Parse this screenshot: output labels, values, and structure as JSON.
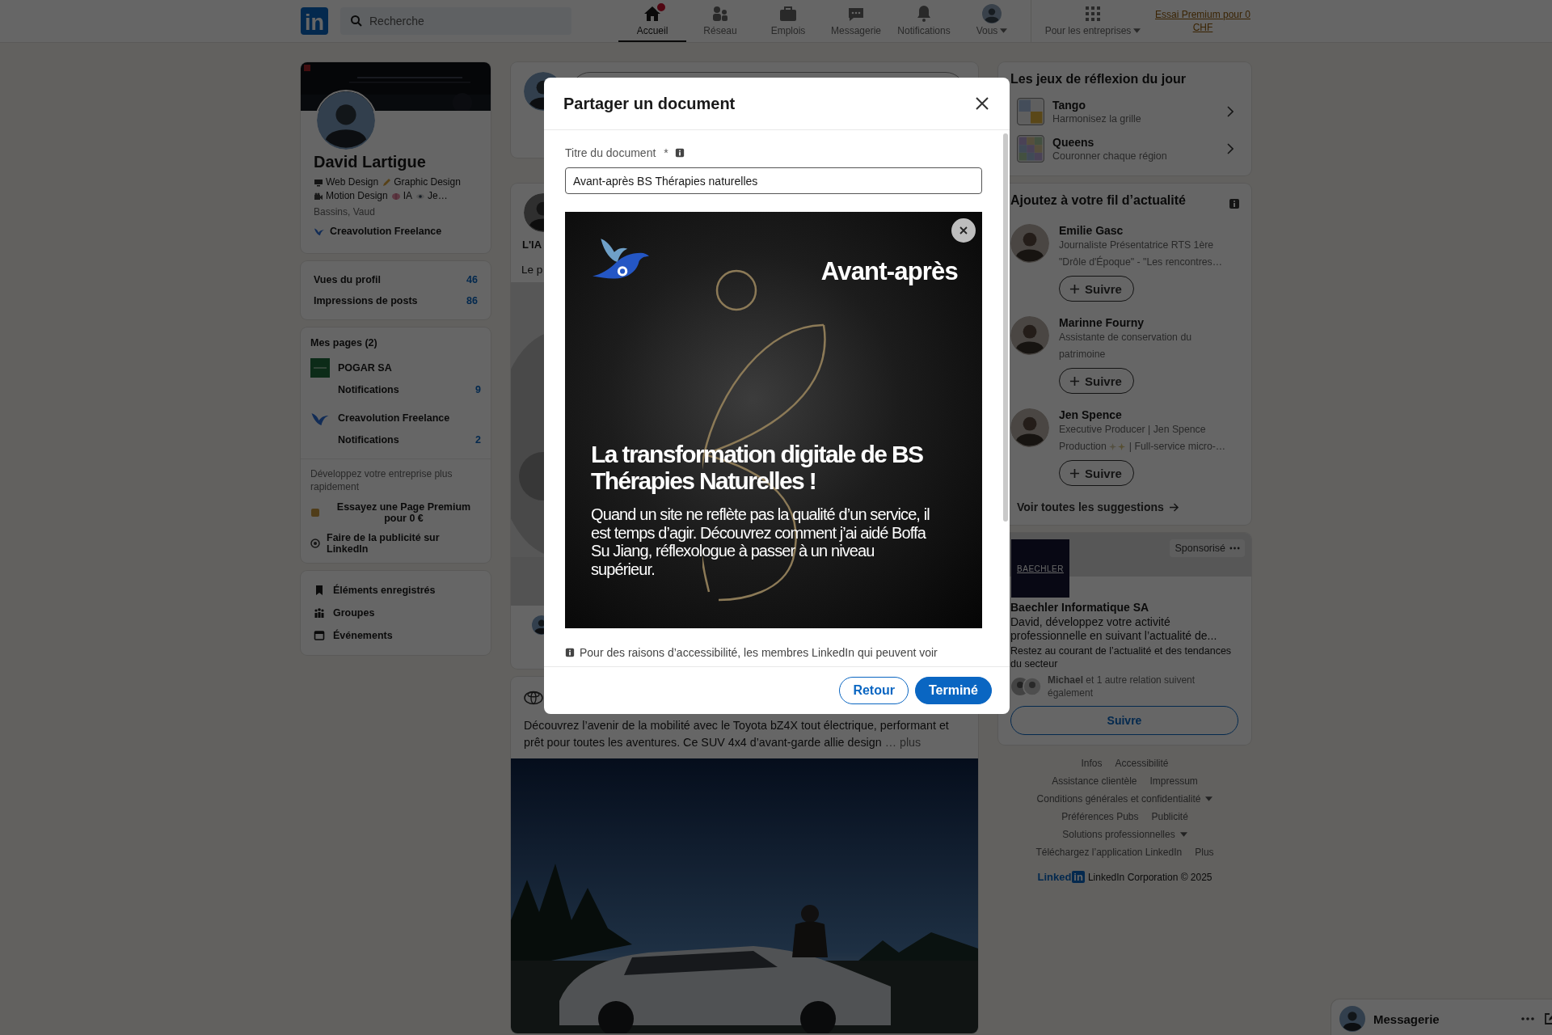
{
  "nav": {
    "logo": "in",
    "search": {
      "placeholder": "Recherche"
    },
    "items": [
      {
        "kind": "home",
        "label": "Accueil",
        "selected": true,
        "badge": true
      },
      {
        "kind": "network",
        "label": "Réseau",
        "selected": false,
        "badge": false
      },
      {
        "kind": "jobs",
        "label": "Emplois",
        "selected": false,
        "badge": false
      },
      {
        "kind": "messaging",
        "label": "Messagerie",
        "selected": false,
        "badge": false
      },
      {
        "kind": "notifications",
        "label": "Notifications",
        "selected": false,
        "badge": false
      },
      {
        "kind": "me",
        "label": "Vous",
        "selected": false,
        "badge": false
      }
    ],
    "business": "Pour les entreprises",
    "premium_link": "Essai Premium pour 0 CHF"
  },
  "profile": {
    "name": "David Lartigue",
    "headline": [
      "Web Design",
      "Graphic Design",
      "Motion Design",
      "IA",
      "Je…"
    ],
    "location": "Bassins, Vaud",
    "company": "Creavolution Freelance"
  },
  "stats": [
    {
      "label": "Vues du profil",
      "value": "46"
    },
    {
      "label": "Impressions de posts",
      "value": "86"
    }
  ],
  "pages": {
    "title": "Mes pages (2)",
    "items": [
      {
        "kind": "pogar",
        "name": "POGAR SA",
        "notif_label": "Notifications",
        "count": "9"
      },
      {
        "kind": "bird",
        "name": "Creavolution Freelance",
        "notif_label": "Notifications",
        "count": "2"
      }
    ],
    "promo": "Développez votre entreprise plus rapidement",
    "actions": [
      {
        "kind": "premium",
        "label": "Essayez une Page Premium pour 0 €"
      },
      {
        "kind": "ads",
        "label": "Faire de la publicité sur LinkedIn"
      }
    ]
  },
  "shortcuts": [
    {
      "kind": "bookmark",
      "label": "Éléments enregistrés"
    },
    {
      "kind": "groups",
      "label": "Groupes"
    },
    {
      "kind": "events",
      "label": "Événements"
    }
  ],
  "feed": {
    "post_author": "L'IA",
    "post_text": "Le p",
    "sponsored_text": "Découvrez l’avenir de la mobilité avec le Toyota bZ4X tout électrique, performant et prêt pour toutes les aventures. Ce SUV 4x4 d’avant-garde allie design",
    "more": "… plus"
  },
  "games": {
    "title": "Les jeux de réflexion du jour",
    "items": [
      {
        "kind": "tango",
        "name": "Tango",
        "subtitle": "Harmonisez la grille"
      },
      {
        "kind": "queens",
        "name": "Queens",
        "subtitle": "Couronner chaque région"
      }
    ]
  },
  "suggestions": {
    "title": "Ajoutez à votre fil d’actualité",
    "people": [
      {
        "name": "Emilie Gasc",
        "lines": [
          [
            "Journaliste Présentatrice RTS 1ère"
          ],
          [
            "\"Drôle d'Époque\" - \"Les rencontres…"
          ]
        ],
        "button": "Suivre"
      },
      {
        "name": "Marinne Fourny",
        "lines": [
          [
            "Assistante de conservation du"
          ],
          [
            "patrimoine"
          ]
        ],
        "button": "Suivre"
      },
      {
        "name": "Jen Spence",
        "lines": [
          [
            "Executive Producer | Jen Spence"
          ],
          [
            "Production",
            "| Full-service micro-…"
          ]
        ],
        "button": "Suivre"
      }
    ],
    "see_all": "Voir toutes les suggestions"
  },
  "ad": {
    "sponsored": "Sponsorisé",
    "logo_text": "BAECHLER",
    "company": "Baechler Informatique SA",
    "headline": "David, développez votre activité professionnelle en suivant l’actualité de...",
    "body": "Restez au courant de l’actualité et des tendances du secteur",
    "social": "**Michael** et 1 autre relation suivent également",
    "button": "Suivre"
  },
  "footer": {
    "rows": [
      [
        {
          "label": "Infos",
          "kind": "link"
        },
        {
          "label": "Accessibilité",
          "kind": "link"
        }
      ],
      [
        {
          "label": "Assistance clientèle",
          "kind": "link"
        },
        {
          "label": "Impressum",
          "kind": "link"
        }
      ],
      [
        {
          "label": "Conditions générales et confidentialité",
          "kind": "menu"
        }
      ],
      [
        {
          "label": "Préférences Pubs",
          "kind": "link"
        },
        {
          "label": "Publicité",
          "kind": "link"
        }
      ],
      [
        {
          "label": "Solutions professionnelles",
          "kind": "menu"
        }
      ],
      [
        {
          "label": "Téléchargez l’application LinkedIn",
          "kind": "link"
        },
        {
          "label": "Plus",
          "kind": "link"
        }
      ]
    ],
    "brand": "Linked",
    "brand_box": "in",
    "copyright": "LinkedIn Corporation © 2025"
  },
  "messaging": {
    "label": "Messagerie"
  },
  "modal": {
    "title": "Partager un document",
    "field_label": "Titre du document",
    "required_mark": "*",
    "value": "Avant-après BS Thérapies naturelles",
    "document": {
      "tag": "Avant-après",
      "headline": "La transformation digitale de BS Thérapies Naturelles !",
      "body": "Quand un site ne reflète pas la qualité d’un service, il est temps d’agir. Découvrez comment j’ai aidé Boffa Su Jiang, réflexologue à passer à un niveau supérieur."
    },
    "note": "Pour des raisons d’accessibilité, les membres LinkedIn qui peuvent voir",
    "buttons": [
      {
        "kind": "secondary",
        "label": "Retour"
      },
      {
        "kind": "primary",
        "label": "Terminé"
      }
    ]
  }
}
